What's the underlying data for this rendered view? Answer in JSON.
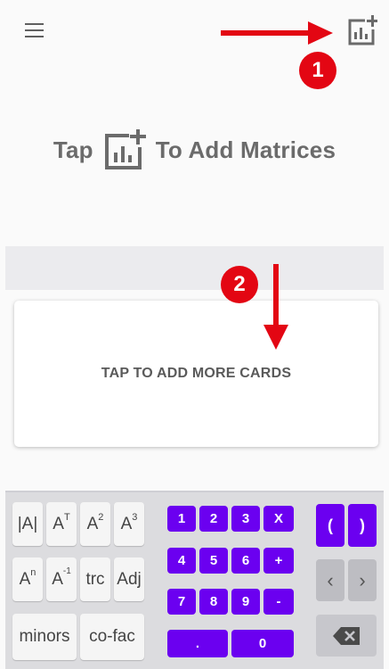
{
  "hint": {
    "before": "Tap",
    "after": "To Add Matrices"
  },
  "card": {
    "label": "TAP TO ADD MORE CARDS"
  },
  "callouts": {
    "one": "1",
    "two": "2"
  },
  "icons": {
    "menu": "hamburger-menu-icon",
    "add_matrix": "add-chart-icon"
  },
  "colors": {
    "accent": "#6b00f0",
    "callout": "#e30613"
  },
  "keyboard": {
    "matrix_ops": {
      "det": "|A|",
      "transpose_base": "A",
      "transpose_sup": "T",
      "square_base": "A",
      "square_sup": "2",
      "cube_base": "A",
      "cube_sup": "3",
      "power_base": "A",
      "power_sup": "n",
      "inverse_base": "A",
      "inverse_sup": "-1",
      "trace": "trc",
      "adjoint": "Adj",
      "minors": "minors",
      "cofactor": "co-fac"
    },
    "numpad": {
      "k1": "1",
      "k2": "2",
      "k3": "3",
      "times": "X",
      "k4": "4",
      "k5": "5",
      "k6": "6",
      "plus": "+",
      "k7": "7",
      "k8": "8",
      "k9": "9",
      "minus": "-",
      "dot": ".",
      "k0": "0"
    },
    "extra": {
      "open_paren": "(",
      "close_paren": ")",
      "left": "‹",
      "right": "›"
    }
  }
}
